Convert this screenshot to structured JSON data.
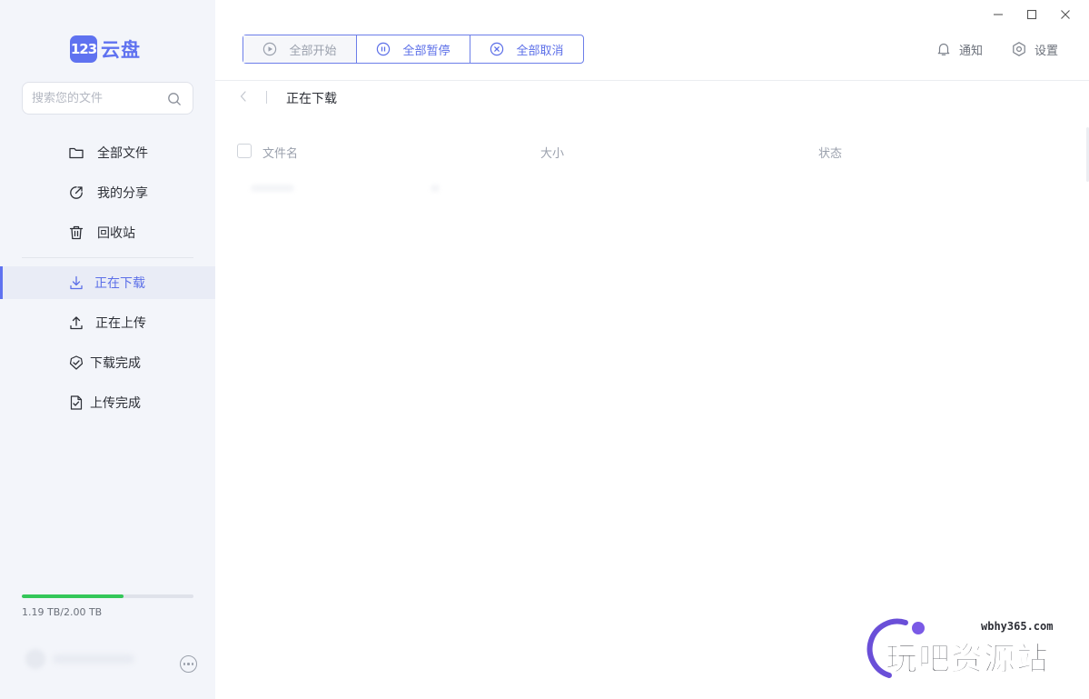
{
  "app": {
    "logo_badge": "123",
    "logo_text": "云盘",
    "brand_color": "#5f72f0"
  },
  "search": {
    "placeholder": "搜索您的文件"
  },
  "sidebar": {
    "items": [
      {
        "label": "全部文件",
        "icon": "folder-icon"
      },
      {
        "label": "我的分享",
        "icon": "share-icon"
      },
      {
        "label": "回收站",
        "icon": "trash-icon"
      },
      {
        "label": "正在下载",
        "icon": "download-icon",
        "active": true
      },
      {
        "label": "正在上传",
        "icon": "upload-icon"
      },
      {
        "label": "下载完成",
        "icon": "check-circle-icon"
      },
      {
        "label": "上传完成",
        "icon": "file-check-icon"
      }
    ]
  },
  "storage": {
    "text": "1.19 TB/2.00 TB",
    "used_fraction": 0.595,
    "bar_color": "#34c759"
  },
  "toolbar": {
    "start_all": "全部开始",
    "pause_all": "全部暂停",
    "cancel_all": "全部取消"
  },
  "header": {
    "notify": "通知",
    "settings": "设置"
  },
  "breadcrumb": {
    "current": "正在下载"
  },
  "table": {
    "columns": [
      "文件名",
      "大小",
      "状态"
    ]
  },
  "watermark": {
    "url": "wbhy365.com",
    "text": "玩吧资源站"
  }
}
